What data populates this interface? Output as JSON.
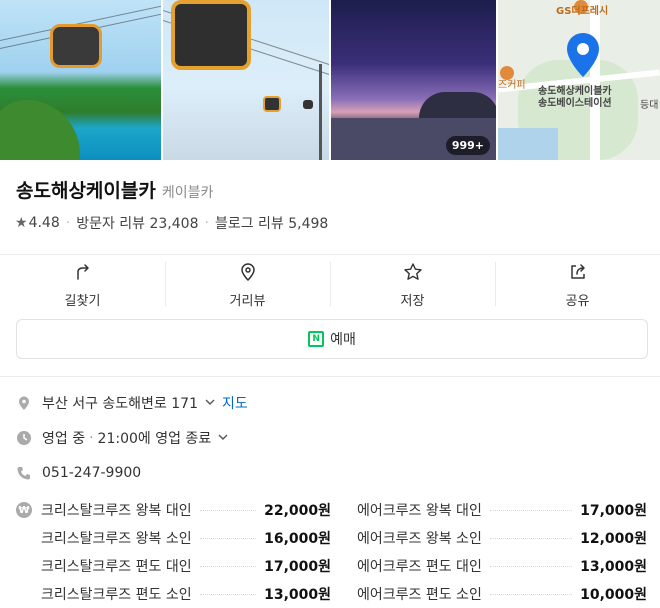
{
  "gallery": {
    "photo_count_badge": "999+"
  },
  "map": {
    "labels": [
      "GS더프레시",
      "즈커피",
      "송도해상케이블카",
      "송도베이스테이션",
      "등대"
    ]
  },
  "place": {
    "name": "송도해상케이블카",
    "category": "케이블카",
    "rating": "4.48",
    "visitor_reviews": "방문자 리뷰 23,408",
    "blog_reviews": "블로그 리뷰 5,498"
  },
  "actions": [
    {
      "label": "길찾기",
      "icon": "directions-icon"
    },
    {
      "label": "거리뷰",
      "icon": "location-pin-icon"
    },
    {
      "label": "저장",
      "icon": "star-icon"
    },
    {
      "label": "공유",
      "icon": "share-icon"
    }
  ],
  "reserve": {
    "label": "예매",
    "icon": "naver-booking-icon",
    "icon_color": "#03c75a"
  },
  "info": {
    "address": "부산 서구 송도해변로 171",
    "map_link": "지도",
    "status": "영업 중",
    "hours": "21:00에 영업 종료",
    "phone": "051-247-9900"
  },
  "prices": {
    "left": [
      {
        "name": "크리스탈크루즈 왕복 대인",
        "value": "22,000원"
      },
      {
        "name": "크리스탈크루즈 왕복 소인",
        "value": "16,000원"
      },
      {
        "name": "크리스탈크루즈 편도 대인",
        "value": "17,000원"
      },
      {
        "name": "크리스탈크루즈 편도 소인",
        "value": "13,000원"
      }
    ],
    "right": [
      {
        "name": "에어크루즈 왕복 대인",
        "value": "17,000원"
      },
      {
        "name": "에어크루즈 왕복 소인",
        "value": "12,000원"
      },
      {
        "name": "에어크루즈 편도 대인",
        "value": "13,000원"
      },
      {
        "name": "에어크루즈 편도 소인",
        "value": "10,000원"
      }
    ]
  },
  "colors": {
    "link": "#0068c3",
    "pin": "#1a73e8",
    "accent_green": "#03c75a"
  }
}
